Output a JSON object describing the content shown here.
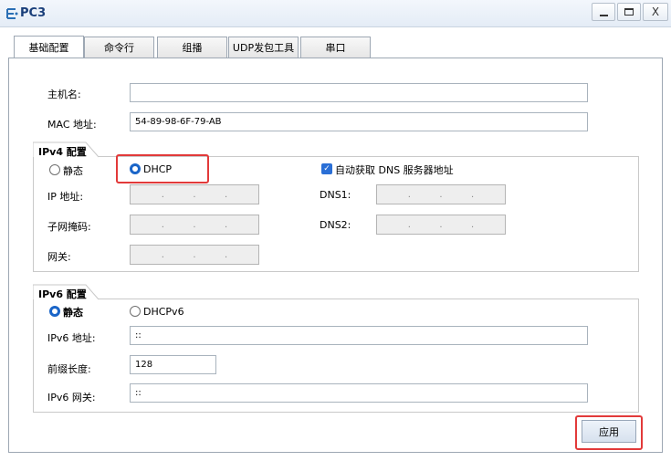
{
  "window": {
    "title": "PC3"
  },
  "tabs": [
    {
      "label": "基础配置",
      "active": true
    },
    {
      "label": "命令行",
      "active": false
    },
    {
      "label": "组播",
      "active": false
    },
    {
      "label": "UDP发包工具",
      "active": false
    },
    {
      "label": "串口",
      "active": false
    }
  ],
  "basic": {
    "hostname_label": "主机名:",
    "hostname_value": "",
    "mac_label": "MAC 地址:",
    "mac_value": "54-89-98-6F-79-AB"
  },
  "ipv4": {
    "group_title": "IPv4 配置",
    "static_label": "静态",
    "dhcp_label": "DHCP",
    "mode": "DHCP",
    "auto_dns_label": "自动获取 DNS 服务器地址",
    "auto_dns_checked": true,
    "ip_label": "IP 地址:",
    "mask_label": "子网掩码:",
    "gateway_label": "网关:",
    "dns1_label": "DNS1:",
    "dns2_label": "DNS2:",
    "ip_dot": "."
  },
  "ipv6": {
    "group_title": "IPv6 配置",
    "static_label": "静态",
    "dhcpv6_label": "DHCPv6",
    "mode": "静态",
    "addr_label": "IPv6 地址:",
    "addr_value": "::",
    "prefix_label": "前缀长度:",
    "prefix_value": "128",
    "gateway_label": "IPv6 网关:",
    "gateway_value": "::"
  },
  "actions": {
    "apply_label": "应用"
  },
  "colors": {
    "highlight": "#e23a3a",
    "accent": "#1a65c8"
  }
}
